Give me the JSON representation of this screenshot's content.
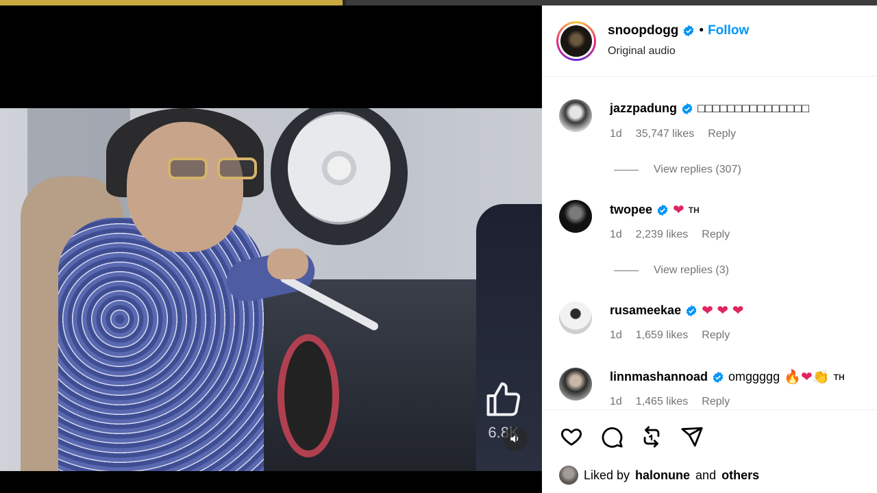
{
  "post": {
    "owner": "snoopdogg",
    "separator": "•",
    "follow_label": "Follow",
    "audio": "Original audio"
  },
  "video": {
    "like_count": "6.8K"
  },
  "comments": [
    {
      "user": "jazzpadung",
      "text": "□□□□□□□□□□□□□□□",
      "age": "1d",
      "likes": "35,747 likes",
      "reply": "Reply",
      "view_replies": "View replies (307)"
    },
    {
      "user": "twopee",
      "text": "❤",
      "flag": "TH",
      "age": "1d",
      "likes": "2,239 likes",
      "reply": "Reply",
      "view_replies": "View replies (3)"
    },
    {
      "user": "rusameekae",
      "text": "❤ ❤ ❤",
      "age": "1d",
      "likes": "1,659 likes",
      "reply": "Reply"
    },
    {
      "user": "linnmashannoad",
      "text": "omggggg",
      "emojis": "🔥❤👏",
      "flag": "TH",
      "age": "1d",
      "likes": "1,465 likes",
      "reply": "Reply"
    }
  ],
  "liked_by": {
    "prefix": "Liked by",
    "user": "halonune",
    "and": "and",
    "others": "others"
  },
  "colors": {
    "accent": "#0095f6",
    "verified": "#0095f6",
    "heart": "#e0245e",
    "meta": "#737373"
  }
}
